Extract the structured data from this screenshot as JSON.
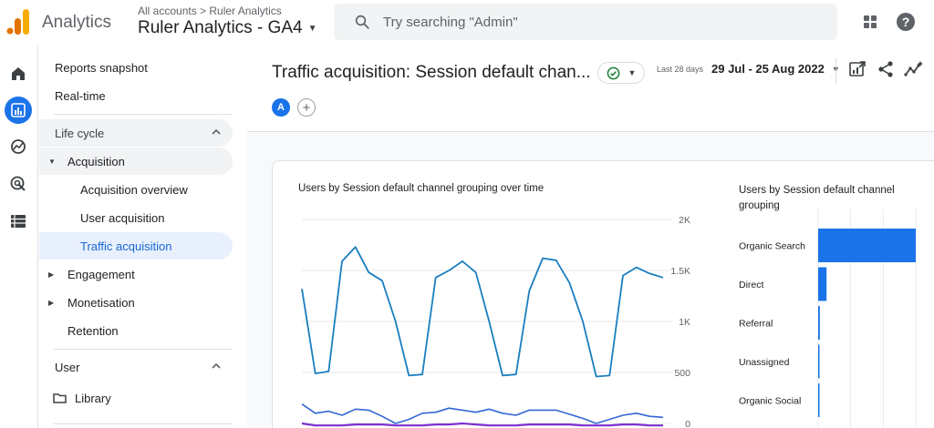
{
  "topbar": {
    "app_name": "Analytics",
    "breadcrumb": "All accounts > Ruler Analytics",
    "property_name": "Ruler Analytics - GA4",
    "search_placeholder": "Try searching \"Admin\""
  },
  "rail": {
    "items": [
      {
        "icon": "home-icon",
        "active": false
      },
      {
        "icon": "reports-icon",
        "active": true
      },
      {
        "icon": "explore-icon",
        "active": false
      },
      {
        "icon": "advertising-icon",
        "active": false
      },
      {
        "icon": "configure-icon",
        "active": false
      }
    ]
  },
  "nav": {
    "reports_snapshot": "Reports snapshot",
    "realtime": "Real-time",
    "lifecycle": "Life cycle",
    "acquisition": "Acquisition",
    "acquisition_overview": "Acquisition overview",
    "user_acquisition": "User acquisition",
    "traffic_acquisition": "Traffic acquisition",
    "engagement": "Engagement",
    "monetisation": "Monetisation",
    "retention": "Retention",
    "user_section": "User",
    "library": "Library"
  },
  "report": {
    "title": "Traffic acquisition: Session default chan...",
    "date_label": "Last 28 days",
    "date_range": "29 Jul - 25 Aug 2022",
    "comparison_badge": "A",
    "add_comparison": "+"
  },
  "colors": {
    "accent": "#1a73e8",
    "line_main": "#1a7ec0",
    "line_secondary": "#3367d6",
    "line_tertiary": "#7b2fd1"
  },
  "chart_data": [
    {
      "type": "line",
      "title": "Users by Session default channel grouping over time",
      "ylim": [
        0,
        2000
      ],
      "yticks": [
        "2K",
        "1.5K",
        "1K",
        "500",
        "0"
      ],
      "series": [
        {
          "values": [
            1320,
            490,
            510,
            1590,
            1730,
            1480,
            1400,
            1000,
            470,
            480,
            1430,
            1500,
            1590,
            1480,
            1000,
            470,
            480,
            1300,
            1620,
            1600,
            1380,
            1000,
            460,
            470,
            1450,
            1530,
            1470,
            1430
          ]
        },
        {
          "values": [
            190,
            100,
            120,
            80,
            140,
            130,
            70,
            0,
            40,
            100,
            110,
            150,
            130,
            110,
            140,
            100,
            80,
            130,
            130,
            130,
            90,
            50,
            0,
            40,
            80,
            100,
            70,
            60
          ]
        },
        {
          "values": [
            0,
            -20,
            -20,
            -20,
            -10,
            -10,
            -10,
            -20,
            -20,
            -20,
            -10,
            -10,
            0,
            -10,
            -20,
            -20,
            -20,
            -10,
            -10,
            -10,
            -10,
            -20,
            -20,
            -20,
            -10,
            -10,
            -20,
            -20
          ]
        }
      ]
    },
    {
      "type": "bar",
      "title": "Users by Session default channel grouping",
      "categories": [
        "Organic Search",
        "Direct",
        "Referral",
        "Unassigned",
        "Organic Social"
      ],
      "values": [
        10500,
        900,
        180,
        20,
        10
      ],
      "xlim": [
        0,
        10500
      ]
    }
  ]
}
